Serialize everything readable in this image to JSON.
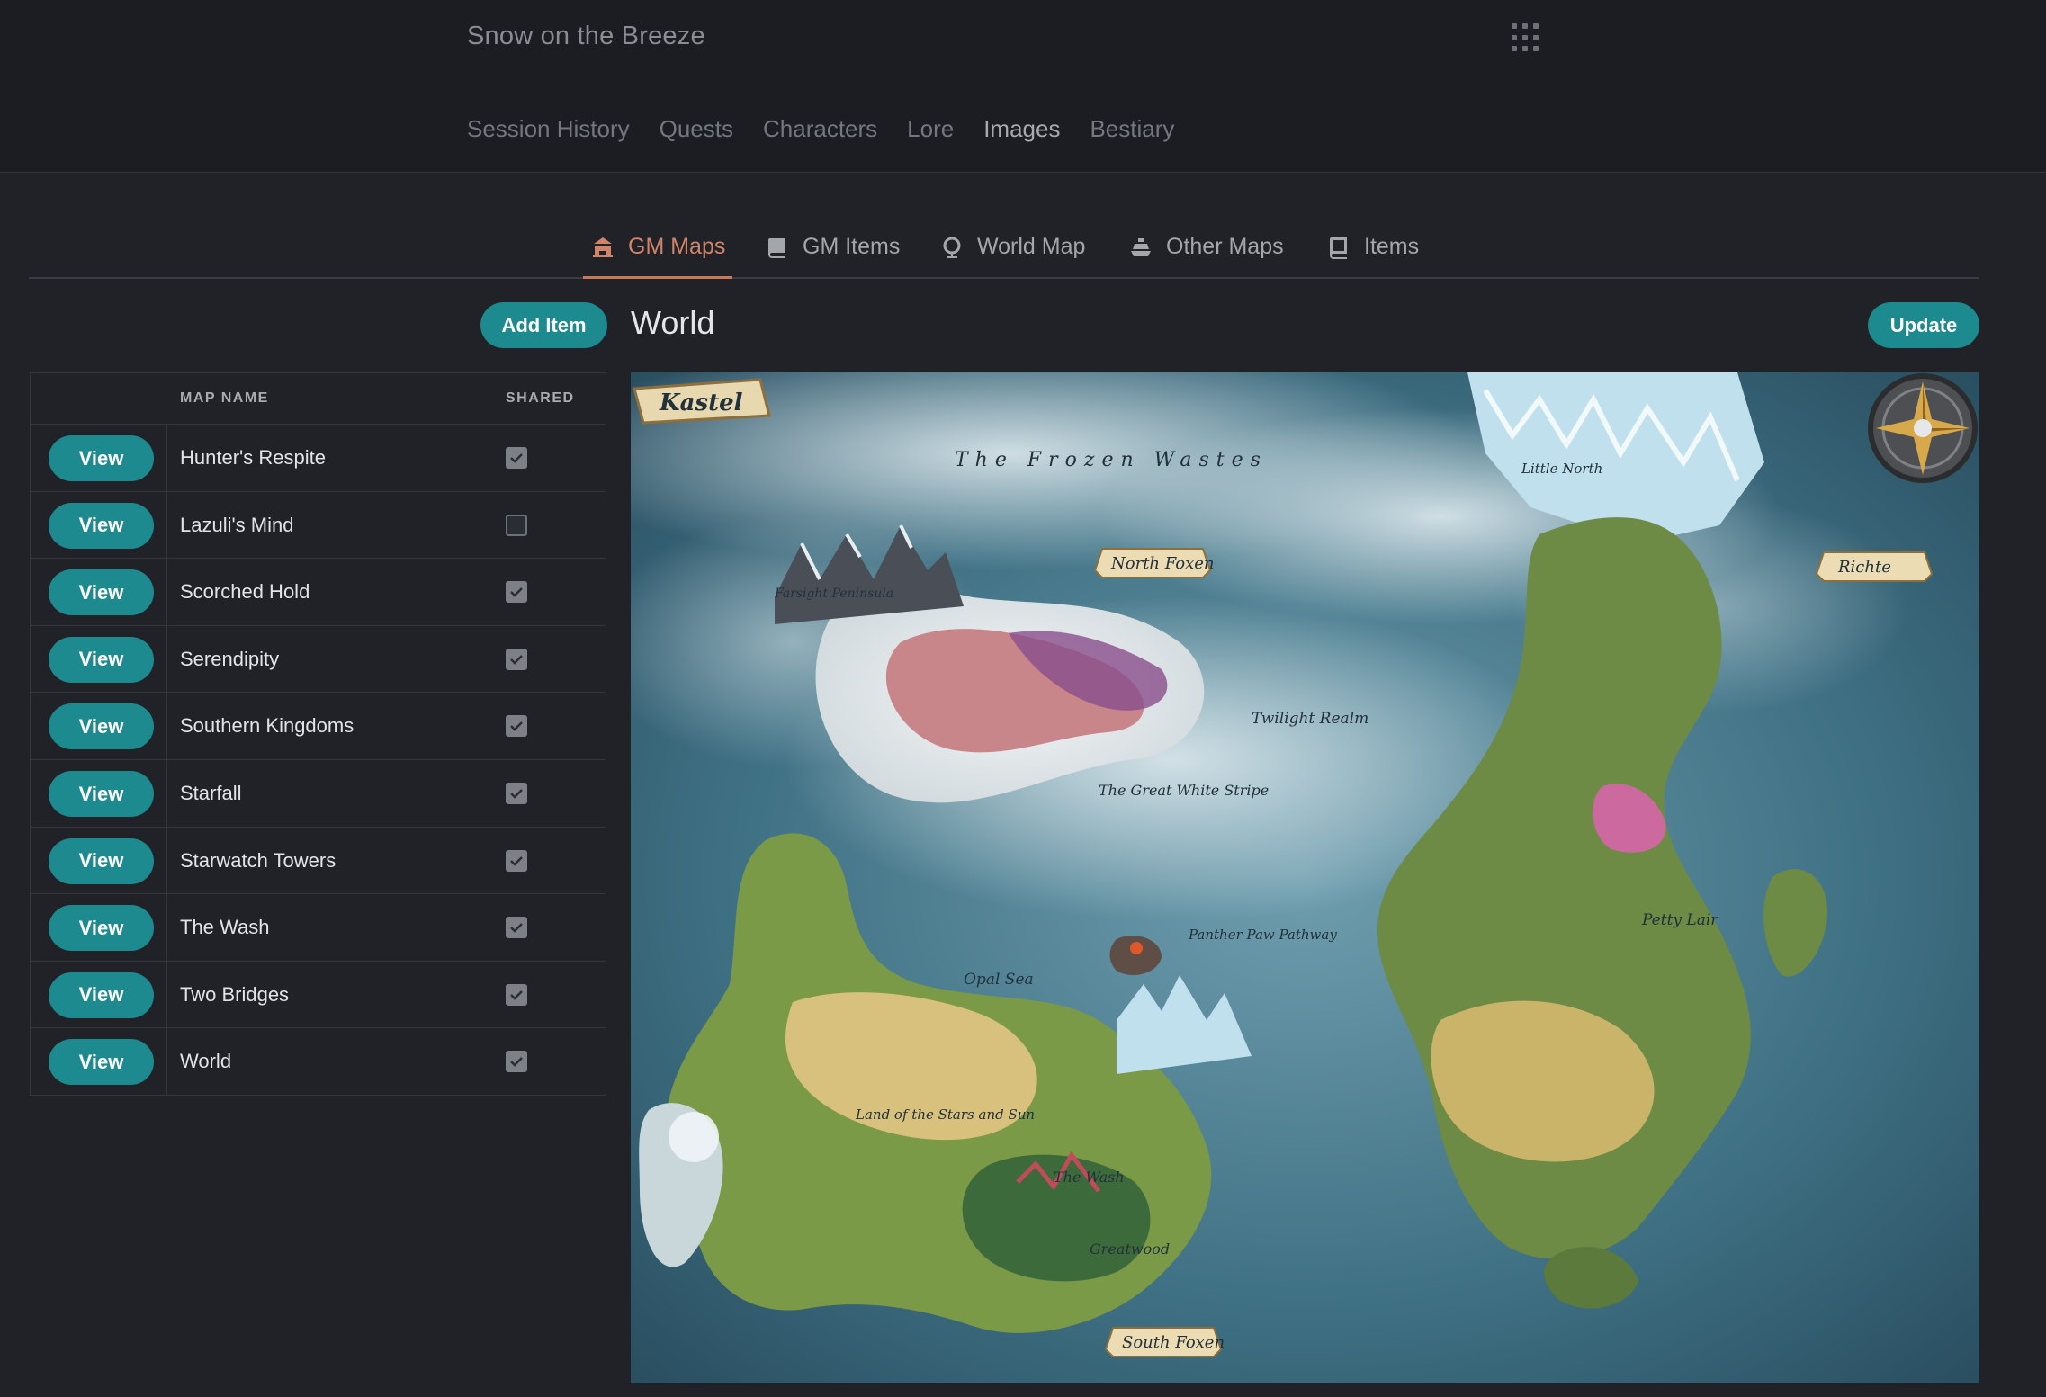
{
  "header": {
    "title": "Snow on the Breeze",
    "nav": [
      "Session History",
      "Quests",
      "Characters",
      "Lore",
      "Images",
      "Bestiary"
    ],
    "active_nav": "Images"
  },
  "tabs": [
    {
      "label": "GM Maps",
      "icon": "castle-icon",
      "active": true
    },
    {
      "label": "GM Items",
      "icon": "book-stack-icon",
      "active": false
    },
    {
      "label": "World Map",
      "icon": "globe-icon",
      "active": false
    },
    {
      "label": "Other Maps",
      "icon": "ship-icon",
      "active": false
    },
    {
      "label": "Items",
      "icon": "book-icon",
      "active": false
    }
  ],
  "toolbar": {
    "add_label": "Add Item",
    "update_label": "Update"
  },
  "section": {
    "title": "World"
  },
  "table": {
    "col_name": "MAP NAME",
    "col_shared": "SHARED",
    "view_label": "View",
    "rows": [
      {
        "name": "Hunter's Respite",
        "shared": true
      },
      {
        "name": "Lazuli's Mind",
        "shared": false
      },
      {
        "name": "Scorched Hold",
        "shared": true
      },
      {
        "name": "Serendipity",
        "shared": true
      },
      {
        "name": "Southern Kingdoms",
        "shared": true
      },
      {
        "name": "Starfall",
        "shared": true
      },
      {
        "name": "Starwatch Towers",
        "shared": true
      },
      {
        "name": "The Wash",
        "shared": true
      },
      {
        "name": "Two Bridges",
        "shared": true
      },
      {
        "name": "World",
        "shared": true
      }
    ]
  },
  "map": {
    "title_banner": "Kastel",
    "labels": {
      "frozen": "The Frozen Wastes",
      "north": "North Foxen",
      "south": "South Foxen",
      "richte": "Richte",
      "twilight": "Twilight Realm",
      "white_stripe": "The Great White Stripe",
      "petty": "Petty Lair",
      "land": "Land of the Stars and Sun",
      "greatwood": "Greatwood",
      "opal": "Opal Sea",
      "panther": "Panther Paw Pathway",
      "wash": "The Wash",
      "little_north": "Little North",
      "farsight": "Farsight Peninsula"
    }
  }
}
